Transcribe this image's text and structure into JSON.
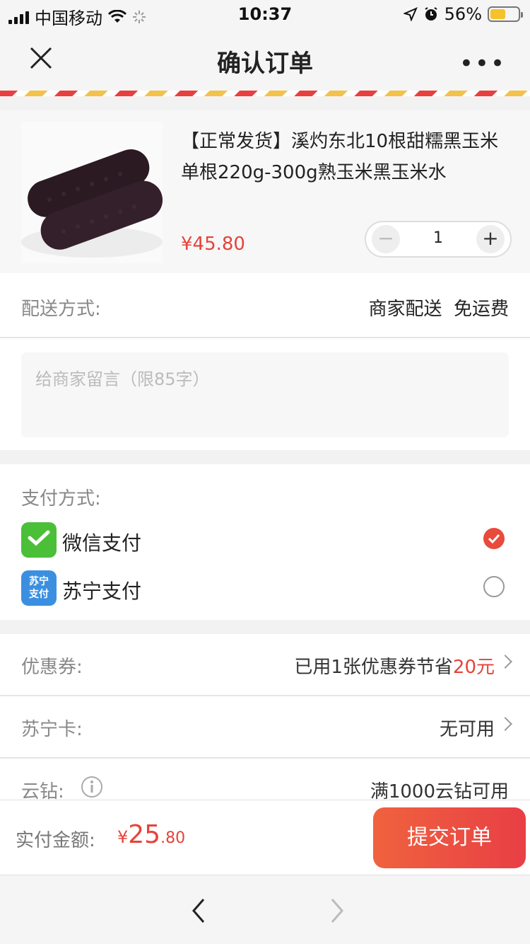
{
  "status_bar": {
    "carrier": "中国移动",
    "time": "10:37",
    "battery": "56%",
    "battery_level": 0.56
  },
  "navbar": {
    "title": "确认订单",
    "more": "•••"
  },
  "product": {
    "name": "【正常发货】溪灼东北10根甜糯黑玉米单根220g-300g熟玉米黑玉米水",
    "price": "¥45.80",
    "quantity": "1",
    "minus": "−",
    "plus": "+"
  },
  "delivery": {
    "label": "配送方式:",
    "value": "商家配送  免运费"
  },
  "message": {
    "placeholder": "给商家留言（限85字）"
  },
  "payment": {
    "label": "支付方式:",
    "options": [
      {
        "label": "微信支付",
        "selected": true,
        "icon": "wechat-pay-icon"
      },
      {
        "label": "苏宁支付",
        "selected": false,
        "icon": "suning-pay-icon",
        "icon_text": "苏宁支付"
      }
    ]
  },
  "coupon": {
    "label": "优惠券:",
    "value_prefix": "已用1张优惠券节省",
    "value_highlight": "20元"
  },
  "suning_card": {
    "label": "苏宁卡:",
    "value": "无可用"
  },
  "cloud_diamond": {
    "label": "云钻:",
    "value": "满1000云钻可用"
  },
  "bottom": {
    "label": "实付金额:",
    "currency": "¥",
    "amount_int": "25",
    "amount_dec": ".80",
    "submit": "提交订单"
  },
  "colors": {
    "accent": "#e5433a",
    "wechat": "#4bbf37",
    "suning": "#3c8fe0"
  }
}
